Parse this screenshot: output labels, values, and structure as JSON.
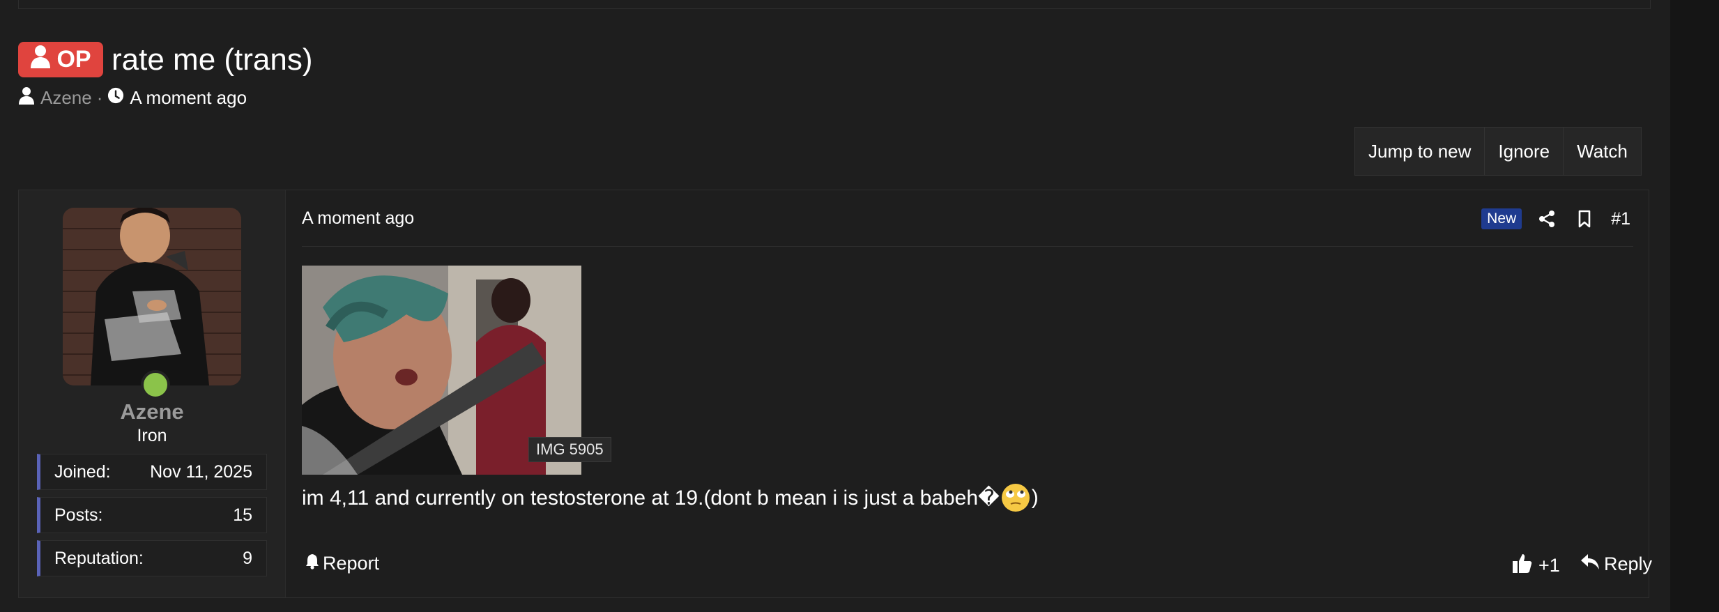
{
  "thread": {
    "op_badge": "OP",
    "title": "rate me (trans)",
    "author": "Azene",
    "separator": "·",
    "time": "A moment ago"
  },
  "actions": {
    "jump_to_new": "Jump to new",
    "ignore": "Ignore",
    "watch": "Watch"
  },
  "post": {
    "user": {
      "name": "Azene",
      "rank": "Iron",
      "online": true,
      "stats": [
        {
          "label": "Joined:",
          "value": "Nov 11, 2025"
        },
        {
          "label": "Posts:",
          "value": "15"
        },
        {
          "label": "Reputation:",
          "value": "9"
        }
      ]
    },
    "time": "A moment ago",
    "new_badge": "New",
    "number": "#1",
    "attachment_caption": "IMG 5905",
    "body_text": "im 4,11 and currently on testosterone at 19.(dont b mean i is just a babeh�",
    "body_text_end": ")",
    "report_label": "Report",
    "like_label": "+1",
    "reply_label": "Reply"
  },
  "colors": {
    "op_badge": "#e0443e",
    "new_badge": "#1f3b8f",
    "online": "#8bc34a",
    "stat_accent": "#5a63b8",
    "muted_text": "#9a9a9a"
  }
}
